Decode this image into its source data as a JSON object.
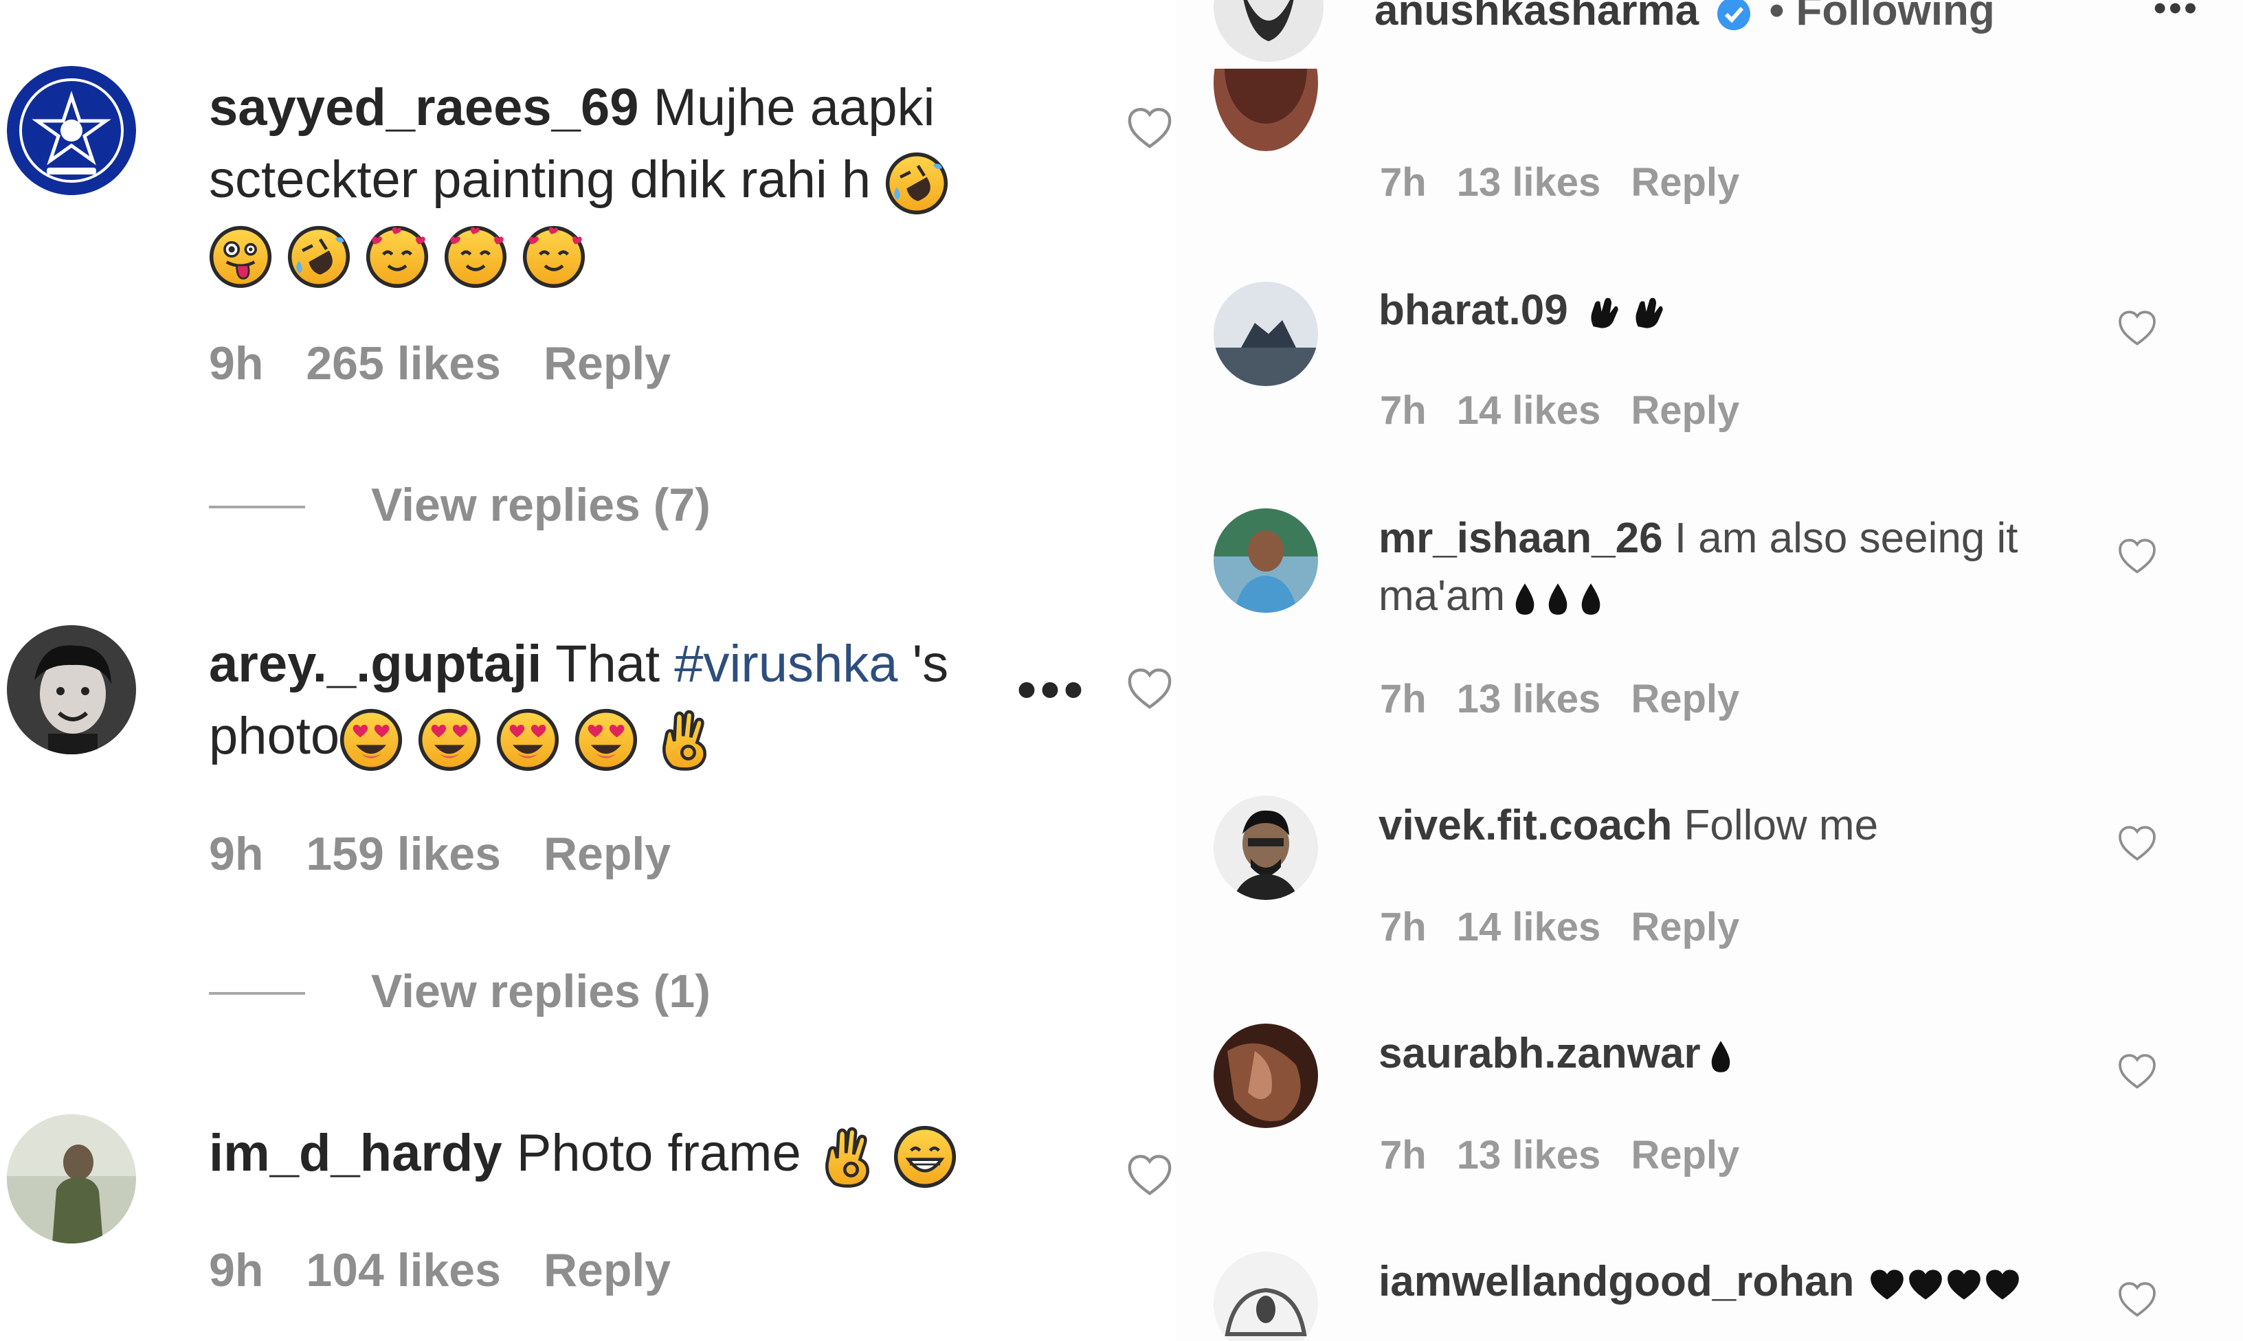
{
  "left": {
    "comments": [
      {
        "username": "sayyed_raees_69",
        "text_line1": "Mujhe aapki",
        "text_line2": "scteckter painting dhik rahi h",
        "time": "9h",
        "likes": "265 likes",
        "reply": "Reply",
        "view_replies": "View replies (7)",
        "emojis": [
          "rofl-emoji",
          "tongue-wink-emoji",
          "rofl-emoji",
          "smiling-hearts-emoji",
          "smiling-hearts-emoji",
          "smiling-hearts-emoji"
        ]
      },
      {
        "username": "arey._.guptaji",
        "text_before": "That",
        "hashtag": "#virushka",
        "text_after": "'s",
        "text_line2": "photo",
        "time": "9h",
        "likes": "159 likes",
        "reply": "Reply",
        "view_replies": "View replies (1)",
        "emojis": [
          "heart-eyes-emoji",
          "heart-eyes-emoji",
          "heart-eyes-emoji",
          "heart-eyes-emoji",
          "ok-hand-emoji"
        ]
      },
      {
        "username": "im_d_hardy",
        "text": "Photo frame",
        "time": "9h",
        "likes": "104 likes",
        "reply": "Reply",
        "emojis": [
          "ok-hand-emoji",
          "grin-emoji"
        ]
      }
    ]
  },
  "right": {
    "header": {
      "username": "anushkasharma",
      "following": "• Following",
      "more": "•••",
      "verified": true
    },
    "comments": [
      {
        "username": "",
        "text": "",
        "time": "7h",
        "likes": "13 likes",
        "reply": "Reply"
      },
      {
        "username": "bharat.09",
        "text": "",
        "time": "7h",
        "likes": "14 likes",
        "reply": "Reply"
      },
      {
        "username": "mr_ishaan_26",
        "text": "I am also seeing it",
        "text_line2": "ma'am",
        "time": "7h",
        "likes": "13 likes",
        "reply": "Reply"
      },
      {
        "username": "vivek.fit.coach",
        "text": "Follow me",
        "time": "7h",
        "likes": "14 likes",
        "reply": "Reply"
      },
      {
        "username": "saurabh.zanwar",
        "text": "",
        "time": "7h",
        "likes": "13 likes",
        "reply": "Reply"
      },
      {
        "username": "iamwellandgood_rohan",
        "text": ""
      }
    ]
  },
  "colors": {
    "text": "#262626",
    "meta": "#8e8e8e",
    "hashtag": "#2d4e7e",
    "verified": "#3897f0",
    "emoji": "#fcc21b"
  }
}
